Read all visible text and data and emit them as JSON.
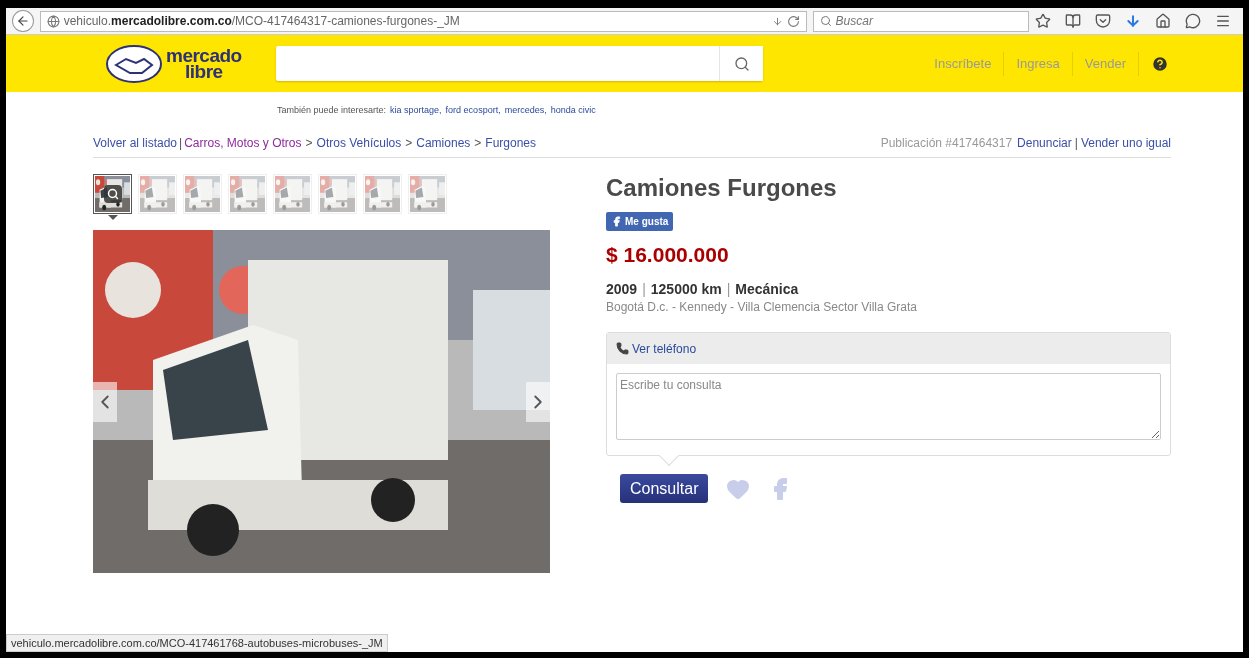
{
  "browser": {
    "url": "vehiculo.**mercadolibre.com.co**/MCO-417464317-camiones-furgones-_JM",
    "search_placeholder": "Buscar"
  },
  "header": {
    "logo_top": "mercado",
    "logo_bottom": "libre",
    "nav": [
      {
        "label": "Inscríbete"
      },
      {
        "label": "Ingresa"
      },
      {
        "label": "Vender"
      }
    ]
  },
  "suggestions": {
    "label": "También puede interesarte:",
    "links": [
      "kia sportage,",
      "ford ecosport,",
      "mercedes,",
      "honda civic"
    ]
  },
  "breadcrumb": {
    "back": "Volver al listado",
    "divider": "|",
    "crumbs": [
      {
        "label": "Carros, Motos y Otros",
        "visited": true
      },
      {
        "separator": ">",
        "label": "Otros Vehículos",
        "visited": false
      },
      {
        "separator": ">",
        "label": "Camiones",
        "visited": false
      },
      {
        "separator": ">",
        "label": "Furgones",
        "visited": false
      }
    ]
  },
  "publication": {
    "number": "Publicación #417464317",
    "links": [
      {
        "label": "Denunciar"
      },
      {
        "separator": "|",
        "label": "Vender uno igual"
      }
    ]
  },
  "gallery": {
    "thumbnails": [
      {
        "selected": true
      },
      {
        "selected": false
      },
      {
        "selected": false
      },
      {
        "selected": false
      },
      {
        "selected": false
      },
      {
        "selected": false
      },
      {
        "selected": false
      },
      {
        "selected": false
      }
    ]
  },
  "listing": {
    "title": "Camiones Furgones",
    "like": "Me gusta",
    "price": "$ 16.000.000",
    "specs": [
      {
        "label": "2009"
      },
      {
        "separator": "|",
        "label": "125000 km"
      },
      {
        "separator": "|",
        "label": "Mecánica"
      }
    ],
    "location": "Bogotá D.c. - Kennedy - Villa Clemencia Sector Villa Grata"
  },
  "contact": {
    "phone_link": "Ver teléfono",
    "placeholder": "Escribe tu consulta",
    "submit": "Consultar"
  },
  "status_bar": "vehiculo.mercadolibre.com.co/MCO-417461768-autobuses-microbuses-_JM"
}
